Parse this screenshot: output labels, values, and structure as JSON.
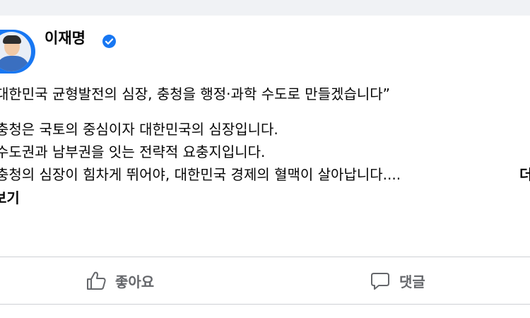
{
  "post": {
    "author": "이재명",
    "lines": [
      "대한민국 균형발전의 심장, 충청을 행정·과학 수도로 만들겠습니다”",
      "충청은 국토의 중심이자 대한민국의 심장입니다.",
      "수도권과 남부권을 잇는 전략적 요충지입니다.",
      "충청의 심장이 힘차게 뛰어야, 대한민국 경제의 혈맥이 살아납니다....",
      "보기"
    ],
    "more_label": "더"
  },
  "actions": {
    "like_label": "좋아요",
    "comment_label": "댓글"
  },
  "icons": {
    "avatar": "profile-photo",
    "verified": "verified-badge-icon",
    "like": "thumbs-up-icon",
    "comment": "speech-bubble-icon"
  },
  "colors": {
    "verified_blue": "#1877f2",
    "action_gray": "#65676b",
    "page_bg": "#f0f2f5",
    "divider": "#ced0d4"
  }
}
